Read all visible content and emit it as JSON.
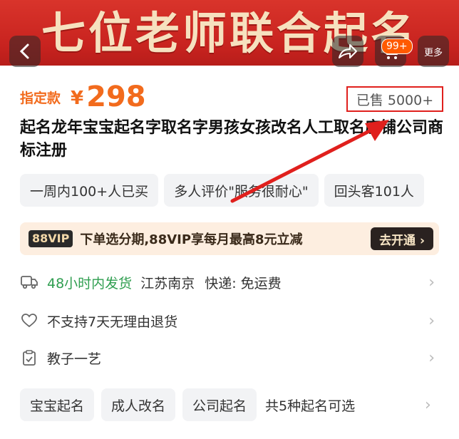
{
  "banner": {
    "title": "七位老师联合起名"
  },
  "nav": {
    "back_icon": "chevron-left-icon",
    "share_icon": "share-icon",
    "cart_icon": "cart-icon",
    "cart_badge": "99+",
    "more_label": "更多"
  },
  "price": {
    "tag": "指定款",
    "currency": "¥",
    "value": "298"
  },
  "sold": "已售 5000+",
  "title": "起名龙年宝宝起名字取名字男孩女孩改名人工取名店铺公司商标注册",
  "tags": [
    "一周内100+人已买",
    "多人评价\"服务很耐心\"",
    "回头客101人"
  ],
  "vip": {
    "badge": "88VIP",
    "text": "下单选分期,88VIP享每月最高8元立减",
    "button": "去开通 ›"
  },
  "shipping": {
    "highlight": "48小时内发货",
    "origin": "江苏南京",
    "courier": "快递: 免运费"
  },
  "returns": "不支持7天无理由退货",
  "seller": "教子一艺",
  "options": {
    "chips": [
      "宝宝起名",
      "成人改名",
      "公司起名"
    ],
    "note": "共5种起名可选"
  },
  "colors": {
    "accent": "#f26b1d",
    "annotation": "#e0201d",
    "green": "#2f9e50"
  }
}
